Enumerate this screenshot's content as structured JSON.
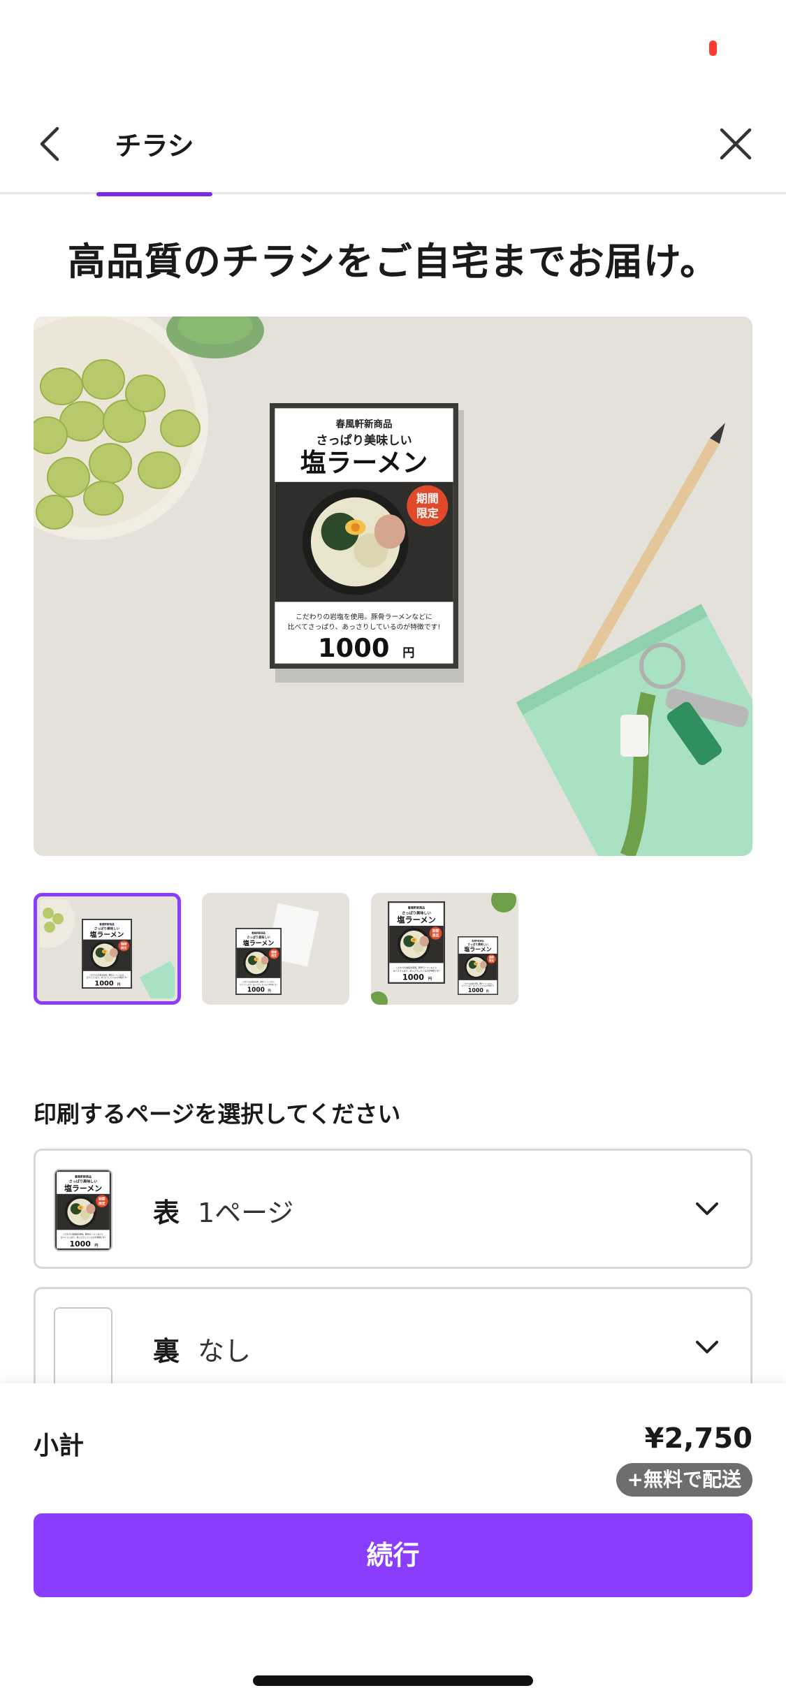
{
  "status_bar": {
    "indicator_color": "#ff3b30"
  },
  "nav": {
    "back_icon": "chevron-left-icon",
    "tab_label": "チラシ",
    "close_icon": "close-icon",
    "accent_color": "#7d2ae8"
  },
  "headline": "高品質のチラシをご自宅までお届け。",
  "flyer": {
    "shop_name": "春風軒新商品",
    "tagline": "さっぱり美味しい",
    "title": "塩ラーメン",
    "badge_line1": "期間",
    "badge_line2": "限定",
    "description_line1": "こだわりの岩塩を使用。豚骨ラーメンなどに",
    "description_line2": "比べてさっぱり、あっさりしているのが特徴です!",
    "price_number": "1000",
    "price_unit": "円"
  },
  "thumbnails": [
    {
      "selected": true
    },
    {
      "selected": false
    },
    {
      "selected": false
    }
  ],
  "print_pages": {
    "label": "印刷するページを選択してください",
    "front": {
      "side": "表",
      "value": "1ページ"
    },
    "back": {
      "side": "裏",
      "value": "なし"
    }
  },
  "checkout": {
    "subtotal_label": "小計",
    "subtotal_price": "¥2,750",
    "shipping_badge": "+無料で配送",
    "continue_label": "続行",
    "button_color": "#8b3dff"
  }
}
